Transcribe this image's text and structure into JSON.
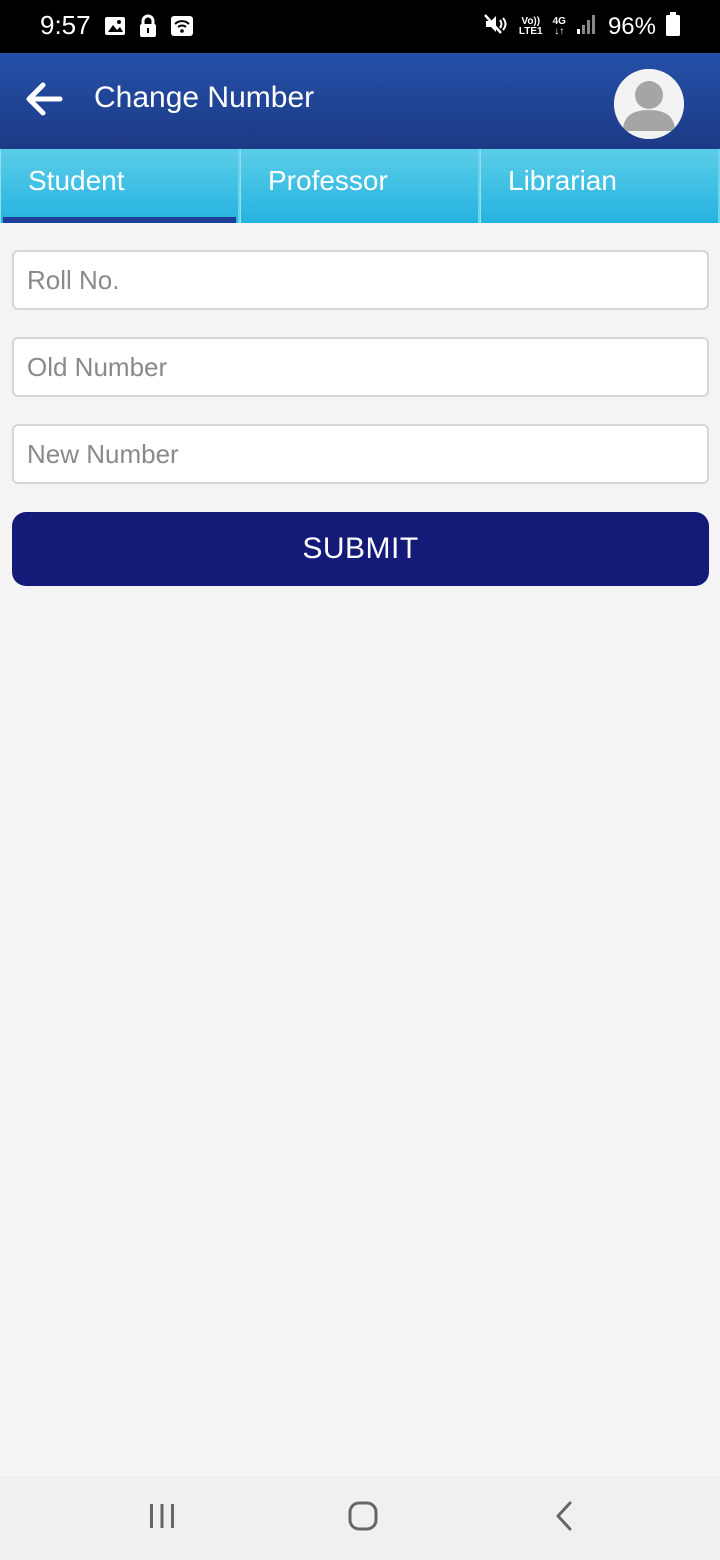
{
  "status_bar": {
    "time": "9:57",
    "network_top": "Vo))",
    "network_bottom": "LTE1",
    "data_type": "4G",
    "battery_percent": "96%",
    "icons": [
      "gallery-icon",
      "lock-icon",
      "wifi-calling-icon",
      "mute-icon",
      "signal-icon",
      "battery-icon"
    ]
  },
  "app_bar": {
    "title": "Change Number",
    "back_icon": "arrow-left-icon",
    "avatar_icon": "user-avatar-icon"
  },
  "tabs": [
    {
      "label": "Student",
      "active": true
    },
    {
      "label": "Professor",
      "active": false
    },
    {
      "label": "Librarian",
      "active": false
    }
  ],
  "form": {
    "roll_no_placeholder": "Roll No.",
    "old_number_placeholder": "Old Number",
    "new_number_placeholder": "New Number",
    "submit_label": "SUBMIT"
  },
  "colors": {
    "app_bar": "#2450a8",
    "tab_bg": "#29b9e0",
    "tab_indicator": "#1f3d99",
    "submit_bg": "#141a78",
    "page_bg": "#f4f4f4"
  },
  "nav_bar": {
    "icons": [
      "recent-apps-icon",
      "home-icon",
      "back-nav-icon"
    ]
  }
}
